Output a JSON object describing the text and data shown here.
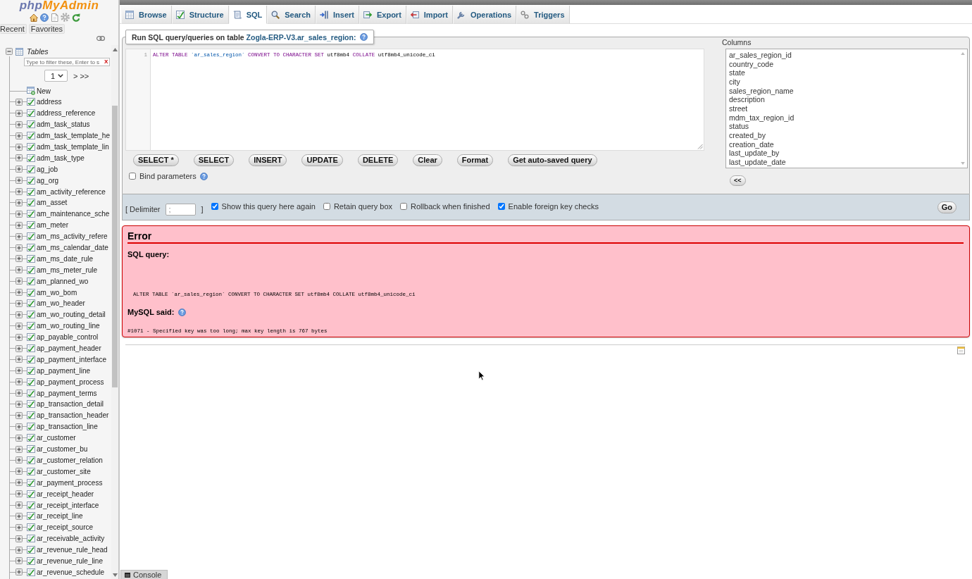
{
  "logo": {
    "prefix": "php",
    "suffix": "MyAdmin"
  },
  "sidebar": {
    "tabs": [
      {
        "label": "Recent"
      },
      {
        "label": "Favorites"
      }
    ],
    "tree": {
      "label": "Tables",
      "expanded": true,
      "filter": {
        "placeholder": "Type to filter these, Enter to s",
        "clear": "X"
      },
      "pager": {
        "page": "1",
        "next": ">",
        "last": ">>"
      },
      "new_item": {
        "label": "New"
      },
      "children": [
        {
          "label": "address",
          "expanded": false
        },
        {
          "label": "address_reference",
          "expanded": false
        },
        {
          "label": "adm_task_status",
          "expanded": false
        },
        {
          "label": "adm_task_template_he",
          "expanded": false
        },
        {
          "label": "adm_task_template_lin",
          "expanded": false
        },
        {
          "label": "adm_task_type",
          "expanded": false
        },
        {
          "label": "ag_job",
          "expanded": false
        },
        {
          "label": "ag_org",
          "expanded": false
        },
        {
          "label": "am_activity_reference",
          "expanded": false
        },
        {
          "label": "am_asset",
          "expanded": false
        },
        {
          "label": "am_maintenance_sche",
          "expanded": false
        },
        {
          "label": "am_meter",
          "expanded": false
        },
        {
          "label": "am_ms_activity_refere",
          "expanded": false
        },
        {
          "label": "am_ms_calendar_date",
          "expanded": false
        },
        {
          "label": "am_ms_date_rule",
          "expanded": false
        },
        {
          "label": "am_ms_meter_rule",
          "expanded": false
        },
        {
          "label": "am_planned_wo",
          "expanded": false
        },
        {
          "label": "am_wo_bom",
          "expanded": false
        },
        {
          "label": "am_wo_header",
          "expanded": false
        },
        {
          "label": "am_wo_routing_detail",
          "expanded": false
        },
        {
          "label": "am_wo_routing_line",
          "expanded": false
        },
        {
          "label": "ap_payable_control",
          "expanded": false
        },
        {
          "label": "ap_payment_header",
          "expanded": false
        },
        {
          "label": "ap_payment_interface",
          "expanded": false
        },
        {
          "label": "ap_payment_line",
          "expanded": false
        },
        {
          "label": "ap_payment_process",
          "expanded": false
        },
        {
          "label": "ap_payment_terms",
          "expanded": false
        },
        {
          "label": "ap_transaction_detail",
          "expanded": false
        },
        {
          "label": "ap_transaction_header",
          "expanded": false
        },
        {
          "label": "ap_transaction_line",
          "expanded": false
        },
        {
          "label": "ar_customer",
          "expanded": false
        },
        {
          "label": "ar_customer_bu",
          "expanded": false
        },
        {
          "label": "ar_customer_relation",
          "expanded": false
        },
        {
          "label": "ar_customer_site",
          "expanded": false
        },
        {
          "label": "ar_payment_process",
          "expanded": false
        },
        {
          "label": "ar_receipt_header",
          "expanded": false
        },
        {
          "label": "ar_receipt_interface",
          "expanded": false
        },
        {
          "label": "ar_receipt_line",
          "expanded": false
        },
        {
          "label": "ar_receipt_source",
          "expanded": false
        },
        {
          "label": "ar_receivable_activity",
          "expanded": false
        },
        {
          "label": "ar_revenue_rule_head",
          "expanded": false
        },
        {
          "label": "ar_revenue_rule_line",
          "expanded": false
        },
        {
          "label": "ar_revenue_schedule",
          "expanded": false
        }
      ]
    }
  },
  "tabs": [
    {
      "label": "Browse",
      "kind": "browse",
      "selected": false
    },
    {
      "label": "Structure",
      "kind": "structure",
      "selected": false
    },
    {
      "label": "SQL",
      "kind": "sql",
      "selected": true
    },
    {
      "label": "Search",
      "kind": "search",
      "selected": false
    },
    {
      "label": "Insert",
      "kind": "insert",
      "selected": false
    },
    {
      "label": "Export",
      "kind": "export",
      "selected": false
    },
    {
      "label": "Import",
      "kind": "import",
      "selected": false
    },
    {
      "label": "Operations",
      "kind": "operations",
      "selected": false
    },
    {
      "label": "Triggers",
      "kind": "triggers",
      "selected": false
    }
  ],
  "query_panel": {
    "legend": {
      "text": "Run SQL query/queries on table",
      "link": "Zogla-ERP-V3.ar_sales_region:"
    },
    "editor": {
      "lines": [
        {
          "number": "1",
          "tokens": [
            {
              "text": "ALTER TABLE",
              "kind": "keyword"
            },
            {
              "text": "`ar_sales_region`",
              "kind": "identifier"
            },
            {
              "text": "CONVERT TO CHARACTER SET",
              "kind": "keyword"
            },
            {
              "text": "utf8mb4",
              "kind": "plain"
            },
            {
              "text": "COLLATE",
              "kind": "keyword"
            },
            {
              "text": "utf8mb4_unicode_ci",
              "kind": "plain"
            }
          ]
        }
      ]
    },
    "buttons": [
      "SELECT *",
      "SELECT",
      "INSERT",
      "UPDATE",
      "DELETE",
      "Clear",
      "Format",
      "Get auto-saved query"
    ],
    "bind_parameters": {
      "label": "Bind parameters",
      "checked": false
    },
    "columns": {
      "label": "Columns",
      "items": [
        "ar_sales_region_id",
        "country_code",
        "state",
        "city",
        "sales_region_name",
        "description",
        "street",
        "mdm_tax_region_id",
        "status",
        "created_by",
        "creation_date",
        "last_update_by",
        "last_update_date"
      ],
      "insert_button": "<<"
    }
  },
  "options_bar": {
    "delimiter_label": "[ Delimiter",
    "delimiter_value": ";",
    "delimiter_close": "]",
    "options": [
      {
        "label": "Show this query here again",
        "checked": true
      },
      {
        "label": "Retain query box",
        "checked": false
      },
      {
        "label": "Rollback when finished",
        "checked": false
      },
      {
        "label": "Enable foreign key checks",
        "checked": true
      }
    ],
    "go_button": "Go"
  },
  "error": {
    "title": "Error",
    "query_label": "SQL query:",
    "query": "ALTER TABLE `ar_sales_region` CONVERT TO CHARACTER SET utf8mb4 COLLATE utf8mb4_unicode_ci",
    "said_label": "MySQL said:",
    "message": "#1071 - Specified key was too long; max key length is 767 bytes"
  },
  "console": {
    "label": "Console"
  }
}
